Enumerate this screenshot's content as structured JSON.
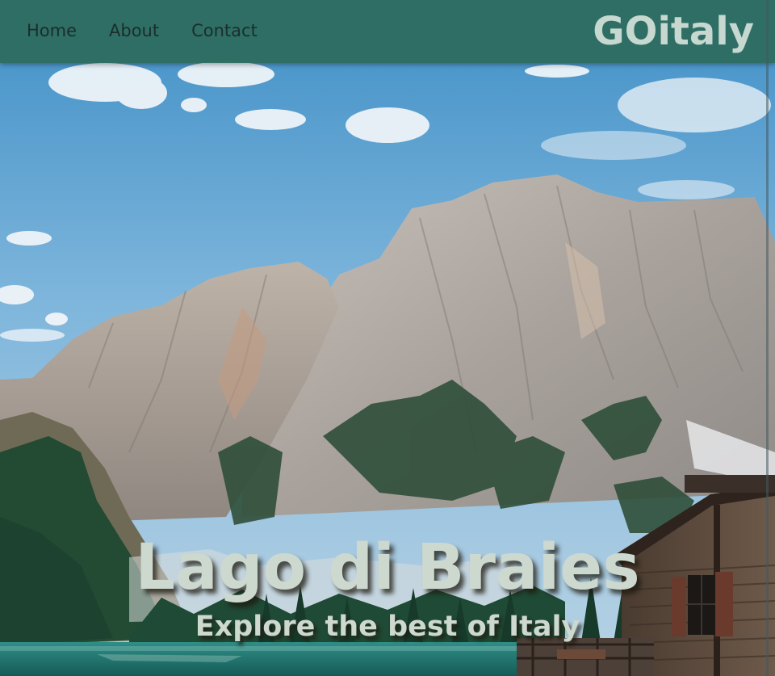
{
  "nav": {
    "items": [
      {
        "label": "Home"
      },
      {
        "label": "About"
      },
      {
        "label": "Contact"
      }
    ],
    "brand": "GOitaly"
  },
  "hero": {
    "title": "Lago di Braies",
    "subtitle": "Explore the best of Italy",
    "image": "mountain-lake-cabin-photo"
  },
  "colors": {
    "navbar": "#2e6c60",
    "nav_text": "#1b2e2a",
    "brand_text": "#c6d8d0",
    "hero_text": "#cdd8cf"
  }
}
